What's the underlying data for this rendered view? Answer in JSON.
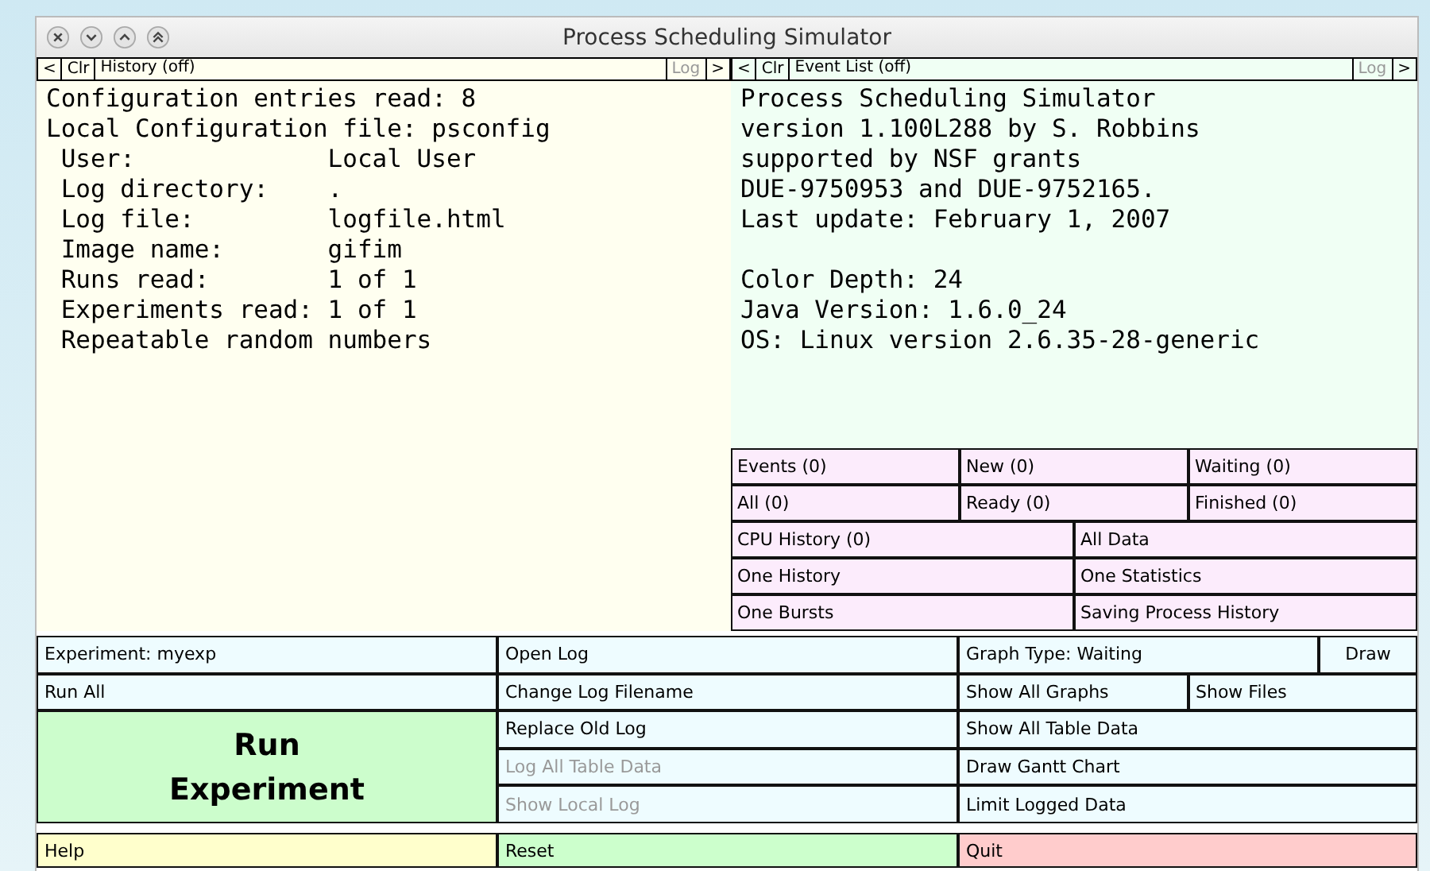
{
  "window": {
    "title": "Process Scheduling Simulator"
  },
  "panels": [
    {
      "header": {
        "prev": "<",
        "clear": "Clr",
        "title": "History (off)",
        "log": "Log",
        "log_disabled": true,
        "next": ">"
      },
      "color": "#fffff0",
      "paragraphs": [
        [
          "Configuration entries read: 8",
          "Local Configuration file: psconfig",
          " User:             Local User",
          " Log directory:    .",
          " Log file:         logfile.html",
          " Image name:       gifim",
          " Runs read:        1 of 1",
          " Experiments read: 1 of 1",
          " Repeatable random numbers"
        ]
      ]
    },
    {
      "header": {
        "prev": "<",
        "clear": "Clr",
        "title": "Event List (off)",
        "log": "Log",
        "log_disabled": true,
        "next": ">"
      },
      "color": "#f0fff4",
      "paragraphs": [
        [
          "Process Scheduling Simulator",
          "version 1.100L288 by S. Robbins",
          "supported by NSF grants",
          "DUE-9750953 and DUE-9752165.",
          "Last update: February 1, 2007"
        ],
        [
          "Color Depth: 24",
          "Java Version: 1.6.0_24",
          "OS: Linux version 2.6.35-28-generic"
        ]
      ]
    }
  ],
  "view_buttons": [
    [
      {
        "label": "Events (0)"
      },
      {
        "label": "New (0)"
      },
      {
        "label": "Waiting (0)"
      }
    ],
    [
      {
        "label": "All (0)"
      },
      {
        "label": "Ready (0)"
      },
      {
        "label": "Finished (0)"
      }
    ],
    [
      {
        "label": "CPU History (0)"
      },
      {
        "label": "All Data"
      }
    ],
    [
      {
        "label": "One History"
      },
      {
        "label": "One Statistics"
      }
    ],
    [
      {
        "label": "One Bursts"
      },
      {
        "label": "Saving Process History"
      }
    ]
  ],
  "controls": [
    [
      [
        {
          "label": "Experiment: myexp",
          "kind": "plain",
          "disabled": false
        }
      ],
      [
        {
          "label": "Run All",
          "kind": "plain",
          "disabled": false
        }
      ],
      [
        {
          "label": "Run Experiment",
          "kind": "big",
          "disabled": false
        }
      ]
    ],
    [
      [
        {
          "label": "Open Log",
          "kind": "plain",
          "disabled": false
        }
      ],
      [
        {
          "label": "Change Log Filename",
          "kind": "plain",
          "disabled": false
        }
      ],
      [
        {
          "label": "Replace Old Log",
          "kind": "plain",
          "disabled": false
        }
      ],
      [
        {
          "label": "Log All Table Data",
          "kind": "plain",
          "disabled": true
        }
      ],
      [
        {
          "label": "Show Local Log",
          "kind": "plain",
          "disabled": true
        }
      ]
    ],
    [
      [
        {
          "label": "Graph Type: Waiting",
          "kind": "plain",
          "disabled": false
        },
        {
          "label": "Draw",
          "kind": "compact",
          "disabled": false
        }
      ],
      [
        {
          "label": "Show All Graphs",
          "kind": "plain",
          "disabled": false
        },
        {
          "label": "Show Files",
          "kind": "plain",
          "disabled": false
        }
      ],
      [
        {
          "label": "Show All Table Data",
          "kind": "plain",
          "disabled": false
        }
      ],
      [
        {
          "label": "Draw Gantt Chart",
          "kind": "plain",
          "disabled": false
        }
      ],
      [
        {
          "label": "Limit Logged Data",
          "kind": "plain",
          "disabled": false
        }
      ]
    ]
  ],
  "footer": [
    {
      "label": "Help",
      "color": "#ffffcc"
    },
    {
      "label": "Reset",
      "color": "#ccffcc"
    },
    {
      "label": "Quit",
      "color": "#ffcccc"
    }
  ]
}
